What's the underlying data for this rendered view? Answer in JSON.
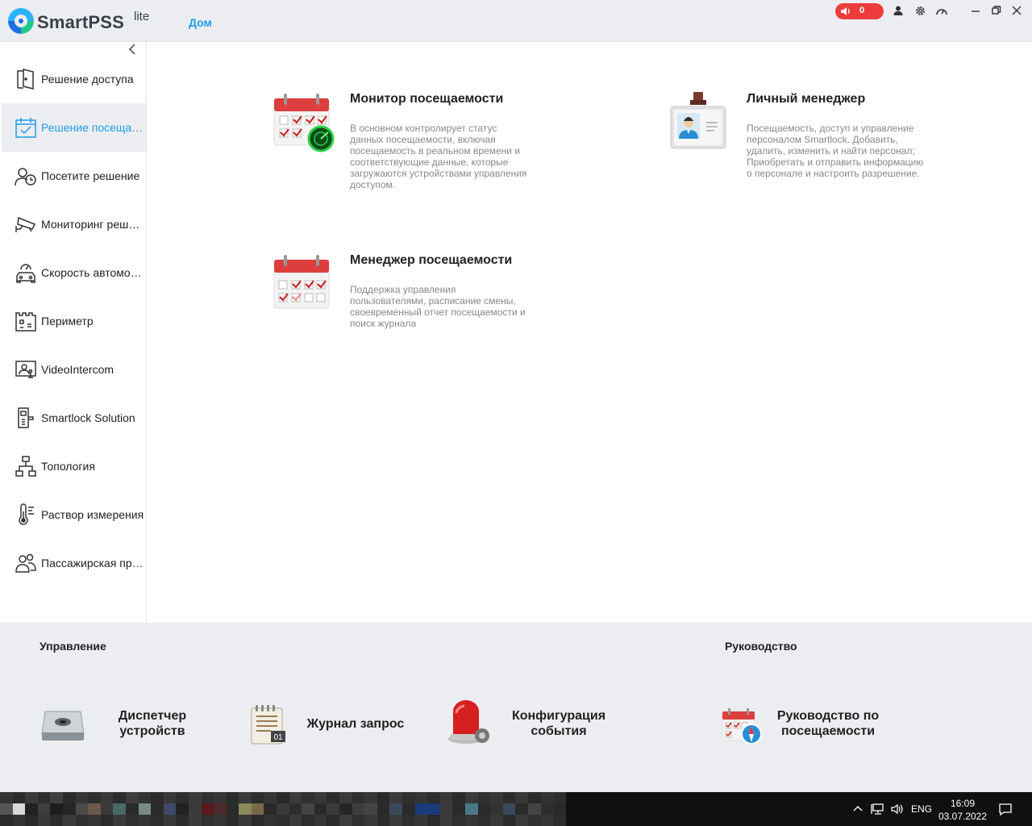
{
  "titlebar": {
    "app_name": "SmartPSS",
    "app_suffix": "lite",
    "home_tab": "Дом",
    "alarm_count": "0",
    "accent": "#1f9de8",
    "alarm_color": "#ee3b3b"
  },
  "sidebar": {
    "items": [
      {
        "label": "Решение доступа",
        "icon": "door-icon"
      },
      {
        "label": "Решение посещаемости",
        "icon": "calendar-check-icon"
      },
      {
        "label": "Посетите решение",
        "icon": "visitor-clock-icon"
      },
      {
        "label": "Мониторинг решений",
        "icon": "cctv-camera-icon"
      },
      {
        "label": "Скорость автомобиля",
        "icon": "car-speedometer-icon"
      },
      {
        "label": "Периметр",
        "icon": "perimeter-icon"
      },
      {
        "label": "VideoIntercom",
        "icon": "intercom-icon"
      },
      {
        "label": "Smartlock Solution",
        "icon": "smartlock-icon"
      },
      {
        "label": "Топология",
        "icon": "topology-icon"
      },
      {
        "label": "Раствор измерения",
        "icon": "thermometer-icon"
      },
      {
        "label": "Пассажирская прогулка",
        "icon": "people-icon"
      }
    ]
  },
  "main": {
    "cards": [
      {
        "title": "Монитор посещаемости",
        "desc": [
          "В основном контролирует статус",
          "данных посещаемости, включая",
          "посещаемость в реальном времени и",
          "соответствующие данные, которые",
          "загружаются устройствами управления",
          "доступом."
        ]
      },
      {
        "title": "Личный менеджер",
        "desc": [
          "Посещаемость, доступ и управление",
          "персоналом Smartlock. Добавить,",
          "удалить, изменить и найти персонал;",
          "Приобретать и отправить информацию",
          "о персонале и настроить разрешение."
        ]
      },
      {
        "title": "Менеджер посещаемости",
        "desc": [
          "Поддержка управления",
          "пользователями, расписание смены,",
          "своевременный отчет посещаемости и",
          "поиск журнала"
        ]
      }
    ]
  },
  "bottom": {
    "management_title": "Управление",
    "guide_title": "Руководство",
    "items": [
      {
        "label": [
          "Диспетчер",
          "устройств"
        ]
      },
      {
        "label": [
          "Журнал запрос"
        ]
      },
      {
        "label": [
          "Конфигурация",
          "события"
        ]
      },
      {
        "label": [
          "Руководство по",
          "посещаемости"
        ]
      }
    ]
  },
  "taskbar": {
    "lang": "ENG",
    "time": "16:09",
    "date": "03.07.2022"
  }
}
